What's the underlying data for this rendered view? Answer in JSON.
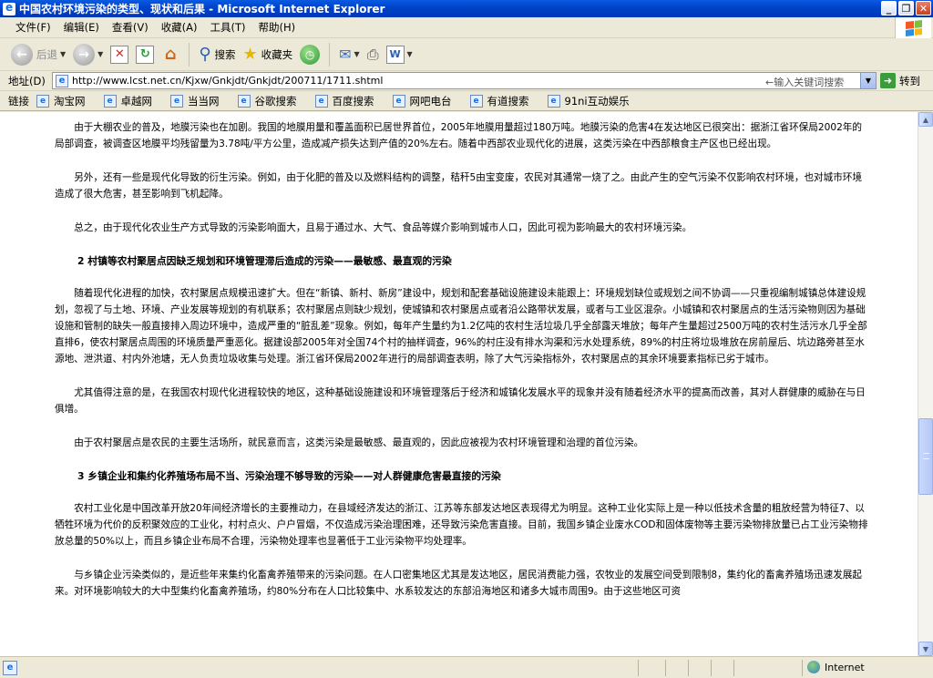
{
  "window": {
    "title": "中国农村环境污染的类型、现状和后果 - Microsoft Internet Explorer",
    "minimize": "_",
    "maximize": "❐",
    "close": "✕"
  },
  "menu": [
    "文件(F)",
    "编辑(E)",
    "查看(V)",
    "收藏(A)",
    "工具(T)",
    "帮助(H)"
  ],
  "toolbar": {
    "back": "后退",
    "search": "搜索",
    "favorites": "收藏夹"
  },
  "address": {
    "label": "地址(D)",
    "url": "http://www.lcst.net.cn/Kjxw/Gnkjdt/Gnkjdt/200711/1711.shtml",
    "search_hint": "←输入关键词搜索",
    "go": "转到"
  },
  "links": {
    "label": "链接",
    "items": [
      "淘宝网",
      "卓越网",
      "当当网",
      "谷歌搜索",
      "百度搜索",
      "网吧电台",
      "有道搜索",
      "91ni互动娱乐"
    ]
  },
  "article": {
    "p1": "由于大棚农业的普及，地膜污染也在加剧。我国的地膜用量和覆盖面积已居世界首位，2005年地膜用量超过180万吨。地膜污染的危害4在发达地区已很突出：据浙江省环保局2002年的局部调查，被调查区地膜平均残留量为3.78吨/平方公里，造成减产损失达到产值的20%左右。随着中西部农业现代化的进展，这类污染在中西部粮食主产区也已经出现。",
    "p2": "另外，还有一些是现代化导致的衍生污染。例如，由于化肥的普及以及燃料结构的调整，秸秆5由宝变废，农民对其通常一烧了之。由此产生的空气污染不仅影响农村环境，也对城市环境造成了很大危害，甚至影响到飞机起降。",
    "p3": "总之，由于现代化农业生产方式导致的污染影响面大，且易于通过水、大气、食品等媒介影响到城市人口，因此可视为影响最大的农村环境污染。",
    "h2": "2 村镇等农村聚居点因缺乏规划和环境管理滞后造成的污染——最敏感、最直观的污染",
    "p4": "随着现代化进程的加快，农村聚居点规模迅速扩大。但在“新镇、新村、新房”建设中，规划和配套基础设施建设未能跟上：环境规划缺位或规划之间不协调——只重视编制城镇总体建设规划，忽视了与土地、环境、产业发展等规划的有机联系；农村聚居点则缺少规划，使城镇和农村聚居点或者沿公路带状发展，或者与工业区混杂。小城镇和农村聚居点的生活污染物则因为基础设施和管制的缺失一般直接排入周边环境中，造成严重的“脏乱差”现象。例如，每年产生量约为1.2亿吨的农村生活垃圾几乎全部露天堆放；每年产生量超过2500万吨的农村生活污水几乎全部直排6，使农村聚居点周围的环境质量严重恶化。据建设部2005年对全国74个村的抽样调查，96%的村庄没有排水沟渠和污水处理系统，89%的村庄将垃圾堆放在房前屋后、坑边路旁甚至水源地、泄洪道、村内外池塘，无人负责垃圾收集与处理。浙江省环保局2002年进行的局部调查表明，除了大气污染指标外，农村聚居点的其余环境要素指标已劣于城市。",
    "p5": "尤其值得注意的是，在我国农村现代化进程较快的地区，这种基础设施建设和环境管理落后于经济和城镇化发展水平的现象并没有随着经济水平的提高而改善，其对人群健康的威胁在与日俱增。",
    "p6": "由于农村聚居点是农民的主要生活场所，就民意而言，这类污染是最敏感、最直观的，因此应被视为农村环境管理和治理的首位污染。",
    "h3": "3 乡镇企业和集约化养殖场布局不当、污染治理不够导致的污染——对人群健康危害最直接的污染",
    "p7": "农村工业化是中国改革开放20年间经济增长的主要推动力，在县域经济发达的浙江、江苏等东部发达地区表现得尤为明显。这种工业化实际上是一种以低技术含量的粗放经营为特征7、以牺牲环境为代价的反积聚效应的工业化，村村点火、户户冒烟，不仅造成污染治理困难，还导致污染危害直接。目前，我国乡镇企业废水COD和固体废物等主要污染物排放量已占工业污染物排放总量的50%以上，而且乡镇企业布局不合理，污染物处理率也显著低于工业污染物平均处理率。",
    "p8": "与乡镇企业污染类似的，是近些年来集约化畜禽养殖带来的污染问题。在人口密集地区尤其是发达地区，居民消费能力强，农牧业的发展空间受到限制8，集约化的畜禽养殖场迅速发展起来。对环境影响较大的大中型集约化畜禽养殖场，约80%分布在人口比较集中、水系较发达的东部沿海地区和诸多大城市周围9。由于这些地区可资"
  },
  "status": {
    "zone": "Internet"
  }
}
